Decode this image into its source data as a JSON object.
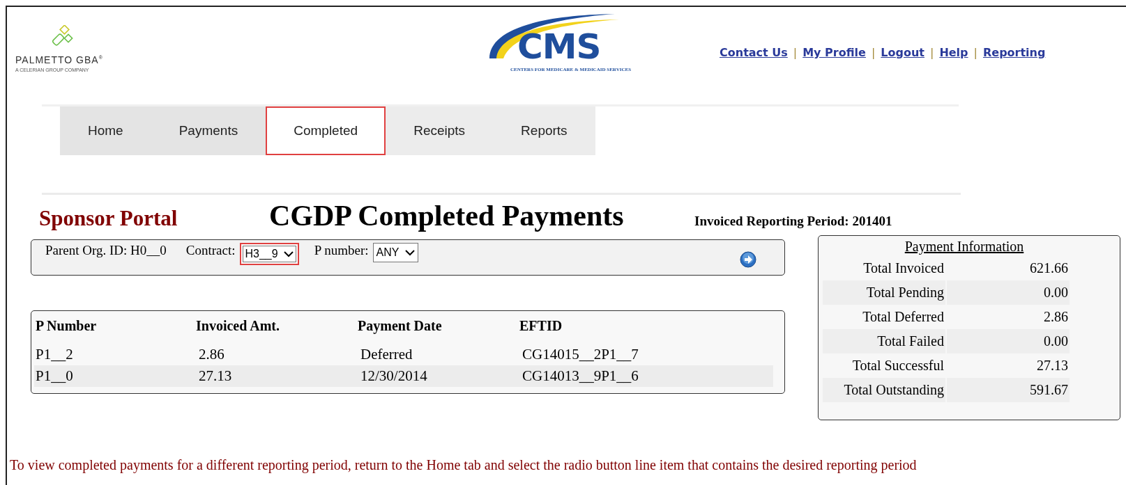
{
  "header": {
    "brand": {
      "name": "PALMETTO GBA",
      "mark": "®",
      "tagline": "A CELERIAN GROUP COMPANY"
    },
    "agency_logo": {
      "letters": "CMS",
      "subtitle": "CENTERS FOR MEDICARE & MEDICAID SERVICES"
    },
    "links": [
      {
        "label": "Contact Us"
      },
      {
        "label": "My Profile"
      },
      {
        "label": "Logout"
      },
      {
        "label": "Help"
      },
      {
        "label": "Reporting"
      }
    ],
    "separator": "|"
  },
  "tabs": [
    {
      "label": "Home",
      "selected": false
    },
    {
      "label": "Payments",
      "selected": false
    },
    {
      "label": "Completed",
      "selected": true
    },
    {
      "label": "Receipts",
      "selected": false
    },
    {
      "label": "Reports",
      "selected": false
    }
  ],
  "portal_name": "Sponsor Portal",
  "page_title": "CGDP Completed Payments",
  "period": "Invoiced Reporting Period: 201401",
  "filters": {
    "parent_org": "Parent Org. ID: H0__0",
    "contract": {
      "label": "Contract:",
      "value": "H3__9",
      "highlighted": true
    },
    "p_number": {
      "label": "P number:",
      "value": "ANY",
      "highlighted": false
    }
  },
  "table": {
    "columns": [
      "P Number",
      "Invoiced Amt.",
      "Payment Date",
      "EFTID"
    ],
    "rows": [
      [
        "P1__2",
        "2.86",
        "Deferred",
        "CG14015__2P1__7"
      ],
      [
        "P1__0",
        "27.13",
        "12/30/2014",
        "CG14013__9P1__6"
      ]
    ]
  },
  "payment_info": {
    "title": "Payment Information",
    "rows": [
      {
        "label": "Total Invoiced",
        "value": "621.66"
      },
      {
        "label": "Total Pending",
        "value": "0.00"
      },
      {
        "label": "Total Deferred",
        "value": "2.86"
      },
      {
        "label": "Total Failed",
        "value": "0.00"
      },
      {
        "label": "Total Successful",
        "value": "27.13"
      },
      {
        "label": "Total Outstanding",
        "value": "591.67"
      }
    ]
  },
  "footer_note": "To view completed payments for a different reporting period, return to the Home tab and select the radio button line item that contains the desired reporting period"
}
